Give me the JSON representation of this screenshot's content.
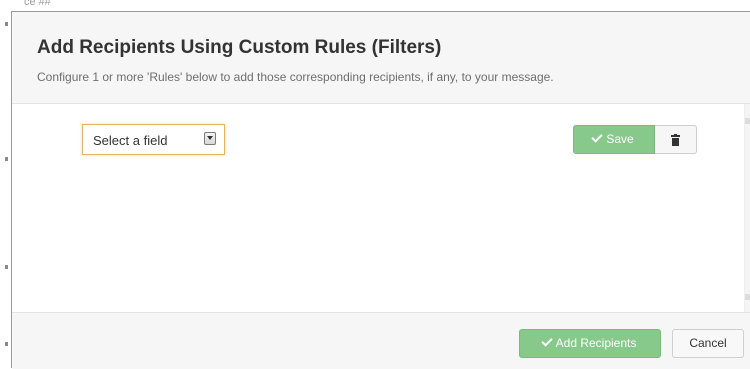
{
  "background": {
    "partial_text": "ce ## "
  },
  "modal": {
    "title": "Add Recipients Using Custom Rules (Filters)",
    "subtitle": "Configure 1 or more 'Rules' below to add those corresponding recipients, if any, to your message."
  },
  "rule": {
    "field_select": {
      "selected": "Select a field",
      "icon": "chevron-down-icon"
    },
    "save_label": "Save",
    "delete_icon": "trash-icon"
  },
  "footer": {
    "add_label": "Add Recipients",
    "cancel_label": "Cancel"
  },
  "colors": {
    "success": "#86c98a",
    "focus_border": "#e3b463",
    "header_bg": "#f6f6f6"
  }
}
